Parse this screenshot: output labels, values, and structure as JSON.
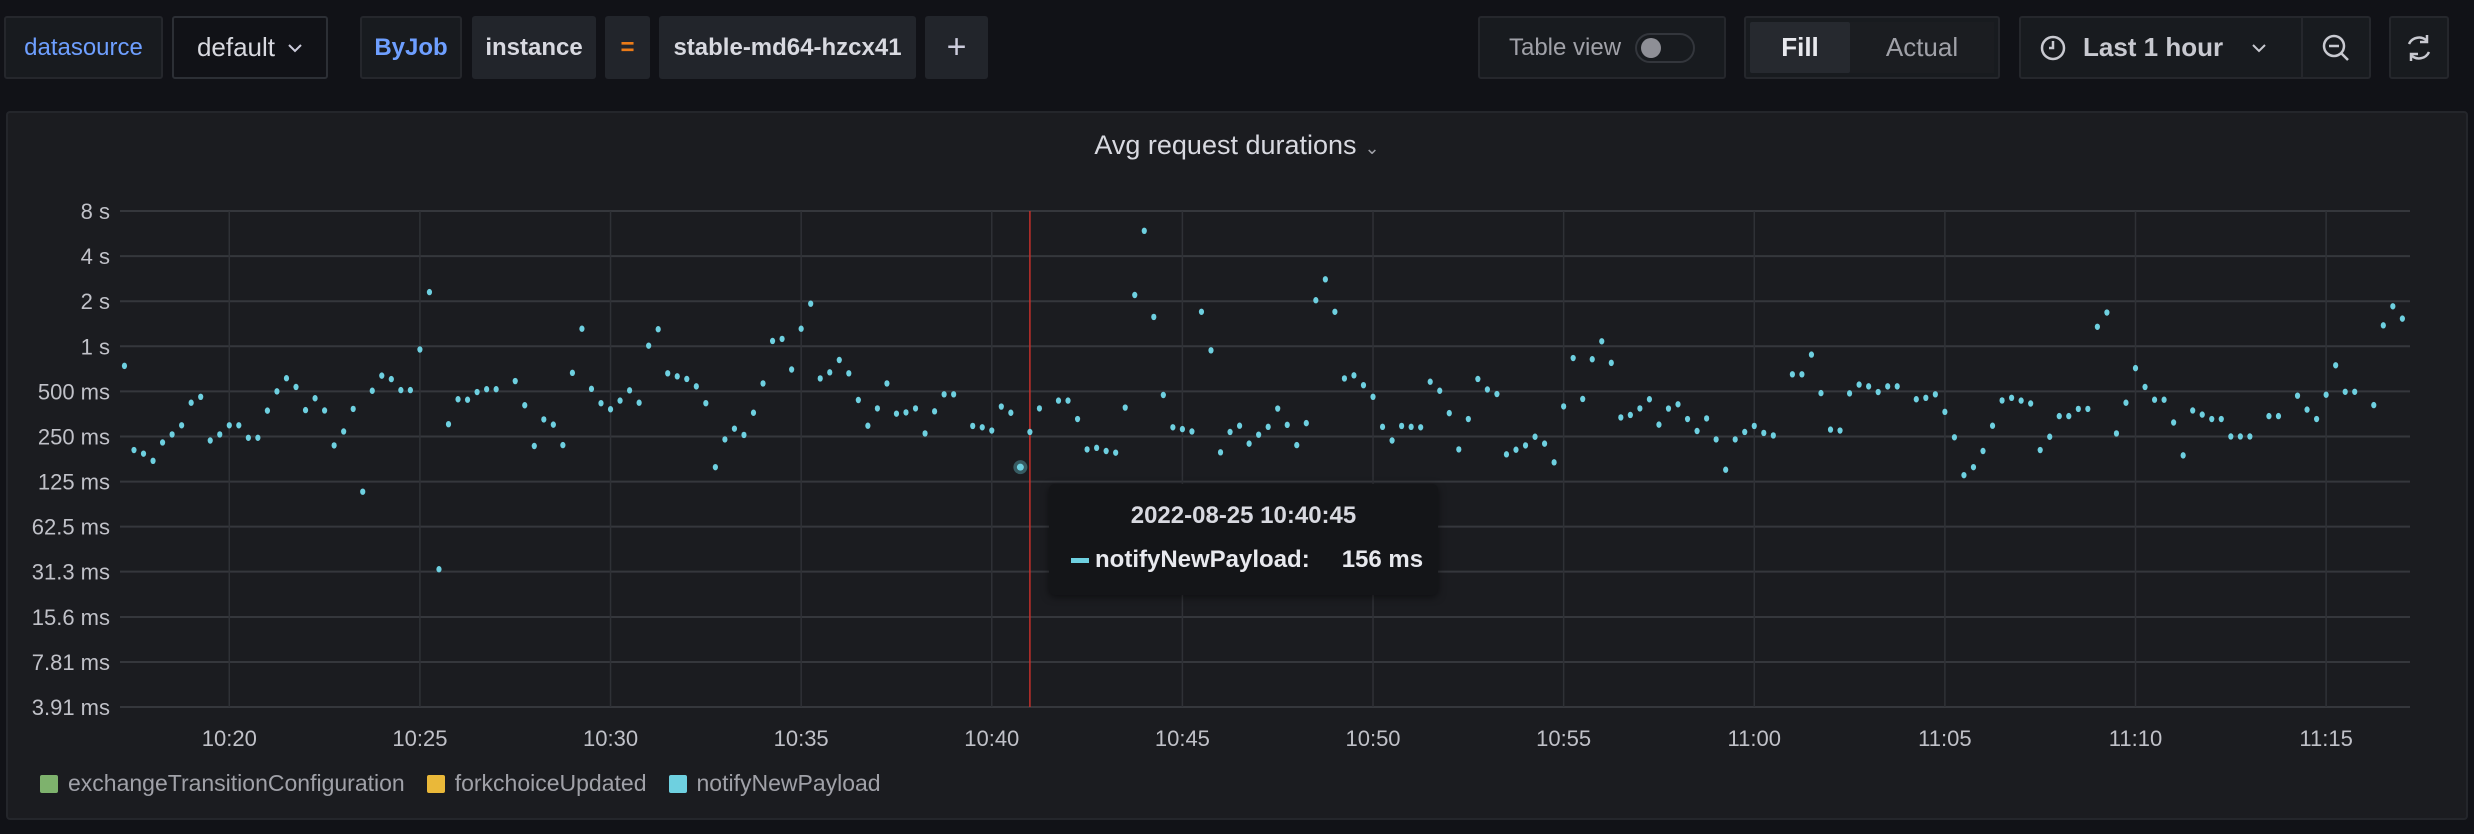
{
  "toolbar": {
    "datasource_label": "datasource",
    "datasource_value": "default",
    "filter_key_group": "ByJob",
    "filter_key": "instance",
    "filter_operator": "=",
    "filter_value": "stable-md64-hzcx41",
    "add_filter": "+",
    "table_view_label": "Table view",
    "table_view_on": false,
    "fill_label": "Fill",
    "actual_label": "Actual",
    "time_range": "Last 1 hour",
    "icons": [
      "chevron-down-icon",
      "plus-icon",
      "clock-icon",
      "zoom-out-icon",
      "refresh-icon"
    ]
  },
  "panel": {
    "title": "Avg request durations",
    "tooltip": {
      "time": "2022-08-25 10:40:45",
      "series": "notifyNewPayload:",
      "value": "156 ms"
    }
  },
  "chart_data": {
    "type": "scatter",
    "title": "Avg request durations",
    "date": "2022-08-25",
    "y_scale": "log2",
    "y_unit": "ms",
    "ylim": [
      3.91,
      8000
    ],
    "y_ticks": [
      {
        "value": 3.91,
        "label": "3.91 ms"
      },
      {
        "value": 7.81,
        "label": "7.81 ms"
      },
      {
        "value": 15.6,
        "label": "15.6 ms"
      },
      {
        "value": 31.3,
        "label": "31.3 ms"
      },
      {
        "value": 62.5,
        "label": "62.5 ms"
      },
      {
        "value": 125,
        "label": "125 ms"
      },
      {
        "value": 250,
        "label": "250 ms"
      },
      {
        "value": 500,
        "label": "500 ms"
      },
      {
        "value": 1000,
        "label": "1 s"
      },
      {
        "value": 2000,
        "label": "2 s"
      },
      {
        "value": 4000,
        "label": "4 s"
      },
      {
        "value": 8000,
        "label": "8 s"
      }
    ],
    "xlim": [
      "10:17:08",
      "11:17:12"
    ],
    "x_ticks": [
      "10:20",
      "10:25",
      "10:30",
      "10:35",
      "10:40",
      "10:45",
      "10:50",
      "10:55",
      "11:00",
      "11:05",
      "11:10",
      "11:15"
    ],
    "grid": true,
    "cursor_time": "10:41:00",
    "cursor_color": "#c4302b",
    "legend_placement": "bottom-left",
    "legend": [
      {
        "name": "exchangeTransitionConfiguration",
        "color": "#7eb26d"
      },
      {
        "name": "forkchoiceUpdated",
        "color": "#eab839"
      },
      {
        "name": "notifyNewPayload",
        "color": "#6ed0e0"
      }
    ],
    "series": [
      {
        "name": "notifyNewPayload",
        "color": "#6ed0e0",
        "start_time": "10:17:15",
        "interval_seconds": 15,
        "highlight_time": "10:40:45",
        "values": [
          740,
          203,
          192,
          172,
          228,
          258,
          297,
          420,
          460,
          235,
          258,
          297,
          297,
          245,
          245,
          372,
          500,
          612,
          535,
          375,
          450,
          373,
          218,
          270,
          382,
          107,
          505,
          637,
          604,
          510,
          510,
          952,
          2300,
          32.5,
          302,
          443,
          440,
          495,
          517,
          517,
          null,
          586,
          404,
          216,
          325,
          300,
          219,
          665,
          1310,
          520,
          417,
          380,
          434,
          508,
          420,
          1010,
          1300,
          660,
          630,
          605,
          540,
          417,
          156,
          239,
          282,
          256,
          360,
          565,
          1085,
          1120,
          700,
          1310,
          1925,
          610,
          670,
          810,
          660,
          438,
          295,
          385,
          565,
          355,
          362,
          385,
          262,
          368,
          478,
          478,
          null,
          294,
          288,
          274,
          396,
          360,
          156,
          268,
          385,
          null,
          434,
          434,
          327,
          205,
          210,
          200,
          195,
          390,
          2200,
          5900,
          1570,
          473,
          288,
          280,
          270,
          1700,
          940,
          196,
          268,
          295,
          224,
          257,
          290,
          384,
          299,
          219,
          307,
          2030,
          2800,
          1700,
          610,
          640,
          550,
          460,
          290,
          235,
          294,
          290,
          288,
          580,
          505,
          358,
          205,
          327,
          605,
          515,
          480,
          190,
          204,
          218,
          249,
          224,
          168,
          397,
          835,
          445,
          820,
          1080,
          775,
          335,
          348,
          385,
          443,
          300,
          384,
          410,
          327,
          272,
          330,
          239,
          150,
          239,
          268,
          294,
          264,
          254,
          null,
          650,
          650,
          880,
          487,
          278,
          274,
          485,
          555,
          540,
          495,
          540,
          540,
          null,
          443,
          453,
          478,
          365,
          247,
          138,
          156,
          200,
          295,
          435,
          453,
          434,
          415,
          203,
          249,
          342,
          342,
          382,
          382,
          1350,
          1680,
          262,
          420,
          715,
          535,
          440,
          440,
          310,
          187,
          373,
          350,
          327,
          327,
          250,
          250,
          250,
          null,
          342,
          342,
          null,
          468,
          378,
          327,
          475,
          747,
          497,
          497,
          null,
          405,
          1380,
          1850,
          1530
        ]
      }
    ]
  }
}
